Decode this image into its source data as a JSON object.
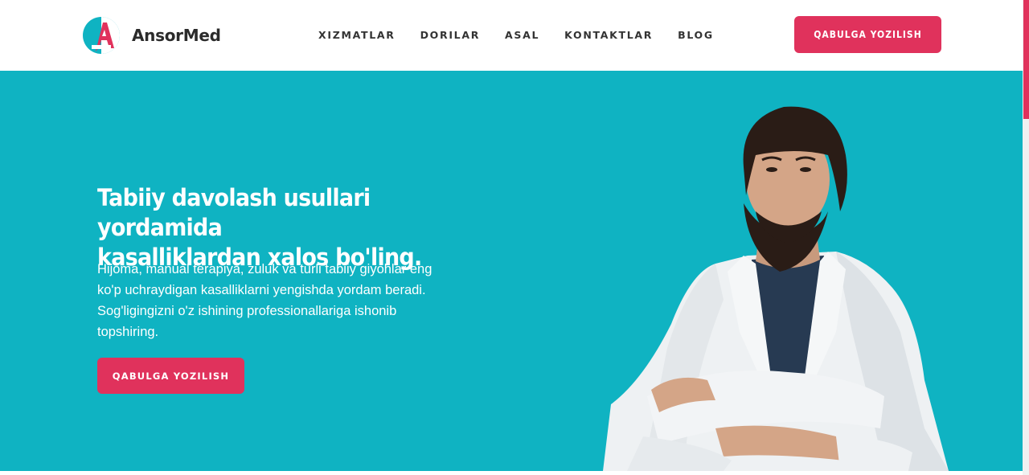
{
  "brand": {
    "name": "AnsorMed",
    "accent": "#e0325c",
    "teal": "#0fb3c2"
  },
  "nav": {
    "items": [
      {
        "label": "XIZMATLAR"
      },
      {
        "label": "DORILAR"
      },
      {
        "label": "ASAL"
      },
      {
        "label": "KONTAKTLAR"
      },
      {
        "label": "BLOG"
      }
    ]
  },
  "header": {
    "cta_label": "QABULGA YOZILISH"
  },
  "hero": {
    "title_line1": "Tabiiy davolash usullari yordamida",
    "title_line2": "kasalliklardan xalos bo'ling.",
    "text": "Hijoma, manual terapiya, zuluk va turli tabiiy giyohlar eng ko'p uchraydigan kasalliklarni yengishda yordam beradi. Sog'ligingizni o'z ishining professionallariga ishonib topshiring.",
    "cta_label": "QABULGA YOZILISH"
  }
}
